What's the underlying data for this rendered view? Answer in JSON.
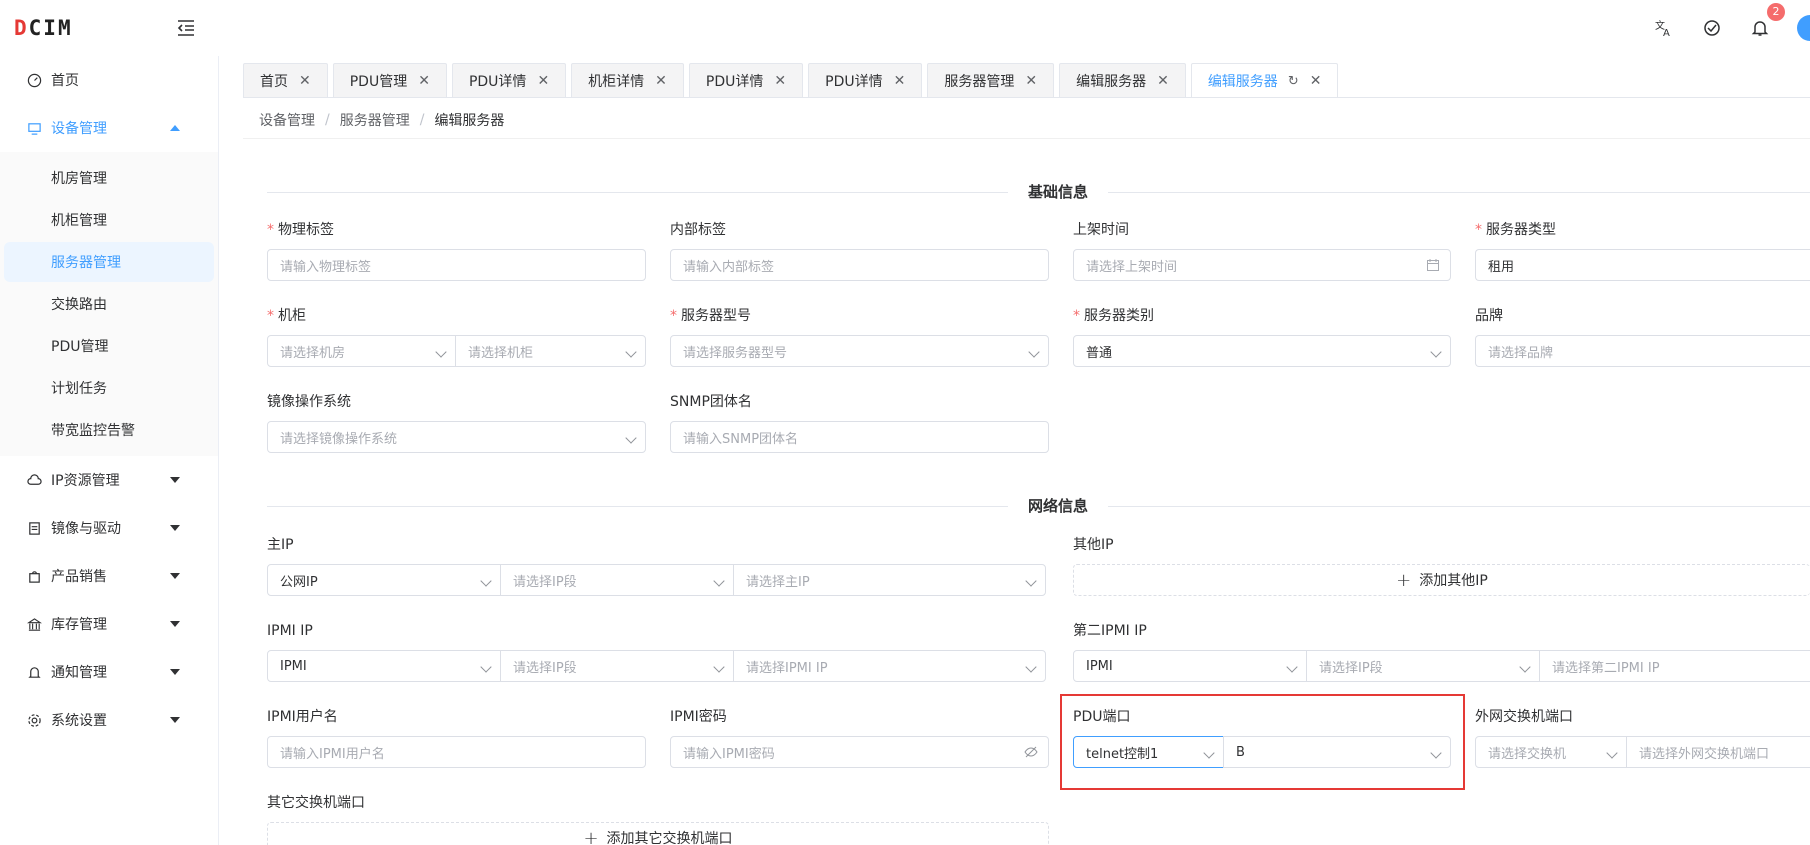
{
  "app": {
    "logo_prefix": "D",
    "logo_rest": "CIM"
  },
  "header": {
    "notification_count": "2",
    "icons": [
      "translate-icon",
      "theme-icon",
      "bell-icon",
      "avatar"
    ]
  },
  "sidebar": {
    "items": [
      {
        "label": "首页",
        "icon": "dashboard-icon"
      },
      {
        "label": "设备管理",
        "icon": "monitor-icon",
        "expanded": true
      },
      {
        "label": "IP资源管理",
        "icon": "cloud-icon"
      },
      {
        "label": "镜像与驱动",
        "icon": "document-icon"
      },
      {
        "label": "产品销售",
        "icon": "shopping-bag-icon"
      },
      {
        "label": "库存管理",
        "icon": "bank-icon"
      },
      {
        "label": "通知管理",
        "icon": "bell-icon"
      },
      {
        "label": "系统设置",
        "icon": "gear-icon"
      }
    ],
    "sub": [
      "机房管理",
      "机柜管理",
      "服务器管理",
      "交换路由",
      "PDU管理",
      "计划任务",
      "带宽监控告警"
    ]
  },
  "tabs": [
    "首页",
    "PDU管理",
    "PDU详情",
    "机柜详情",
    "PDU详情",
    "PDU详情",
    "服务器管理",
    "编辑服务器",
    "编辑服务器"
  ],
  "breadcrumb": [
    "设备管理",
    "服务器管理",
    "编辑服务器"
  ],
  "sections": {
    "basic": "基础信息",
    "network": "网络信息"
  },
  "fields": {
    "physical_tag": {
      "label": "物理标签",
      "ph": "请输入物理标签"
    },
    "internal_tag": {
      "label": "内部标签",
      "ph": "请输入内部标签"
    },
    "shelf_time": {
      "label": "上架时间",
      "ph": "请选择上架时间"
    },
    "server_type": {
      "label": "服务器类型",
      "value": "租用"
    },
    "cabinet": {
      "label": "机柜",
      "ph_room": "请选择机房",
      "ph_cabinet": "请选择机柜"
    },
    "server_model": {
      "label": "服务器型号",
      "ph": "请选择服务器型号"
    },
    "server_category": {
      "label": "服务器类别",
      "value": "普通"
    },
    "brand": {
      "label": "品牌",
      "ph": "请选择品牌"
    },
    "image_os": {
      "label": "镜像操作系统",
      "ph": "请选择镜像操作系统"
    },
    "snmp": {
      "label": "SNMP团体名",
      "ph": "请输入SNMP团体名"
    },
    "main_ip": {
      "label": "主IP",
      "type": "公网IP",
      "ph_seg": "请选择IP段",
      "ph_ip": "请选择主IP"
    },
    "other_ip": {
      "label": "其他IP",
      "btn": "添加其他IP"
    },
    "ipmi_ip": {
      "label": "IPMI IP",
      "type": "IPMI",
      "ph_seg": "请选择IP段",
      "ph_ip": "请选择IPMI IP"
    },
    "ipmi_ip2": {
      "label": "第二IPMI IP",
      "type": "IPMI",
      "ph_seg": "请选择IP段",
      "ph_ip": "请选择第二IPMI IP"
    },
    "ipmi_user": {
      "label": "IPMI用户名",
      "ph": "请输入IPMI用户名"
    },
    "ipmi_pass": {
      "label": "IPMI密码",
      "ph": "请输入IPMI密码"
    },
    "pdu_port": {
      "label": "PDU端口",
      "control": "telnet控制1",
      "port": "B"
    },
    "ext_switch": {
      "label": "外网交换机端口",
      "ph_switch": "请选择交换机",
      "ph_port": "请选择外网交换机端口"
    },
    "other_switch": {
      "label": "其它交换机端口",
      "btn": "添加其它交换机端口"
    }
  },
  "colors": {
    "primary": "#409eff",
    "danger": "#e53935"
  }
}
